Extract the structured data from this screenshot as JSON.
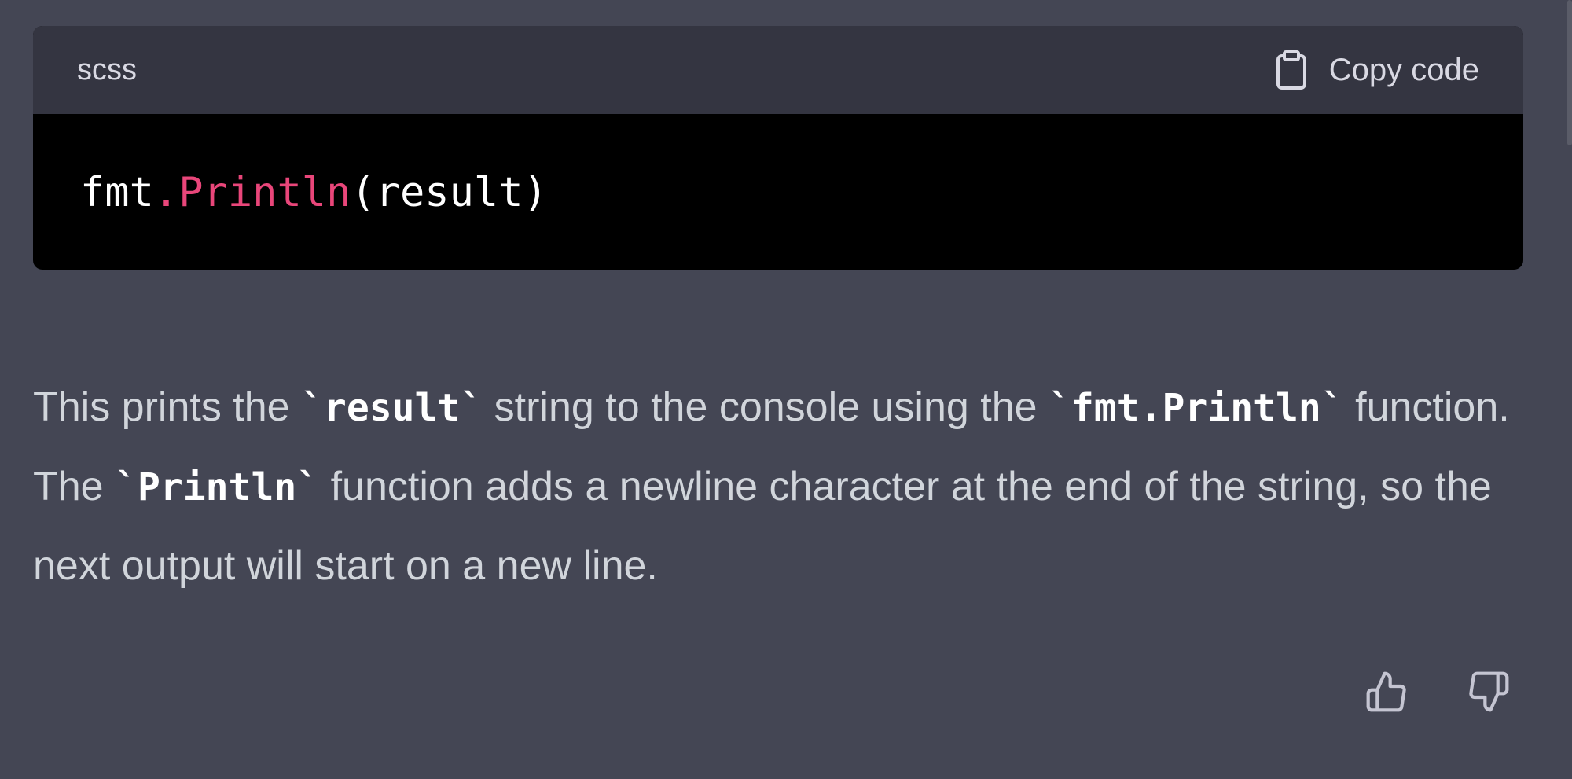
{
  "code_block": {
    "language": "scss",
    "copy_label": "Copy code",
    "code": {
      "object": "fmt",
      "method": ".Println",
      "args": "(result)"
    }
  },
  "answer": {
    "segments": [
      {
        "type": "text",
        "value": "This prints the "
      },
      {
        "type": "code",
        "value": "`result`"
      },
      {
        "type": "text",
        "value": " string to the console using the "
      },
      {
        "type": "code",
        "value": "`fmt.Println`"
      },
      {
        "type": "text",
        "value": " function. The "
      },
      {
        "type": "code",
        "value": "`Println`"
      },
      {
        "type": "text",
        "value": " function adds a newline character at the end of the string, so the next output will start on a new line."
      }
    ]
  },
  "feedback": {
    "thumbs_up_icon": "thumbs-up-icon",
    "thumbs_down_icon": "thumbs-down-icon"
  },
  "colors": {
    "page_background": "#444654",
    "code_header": "#343541",
    "code_background": "#000000",
    "method_token": "#e9467a",
    "text": "#d1d5db"
  }
}
